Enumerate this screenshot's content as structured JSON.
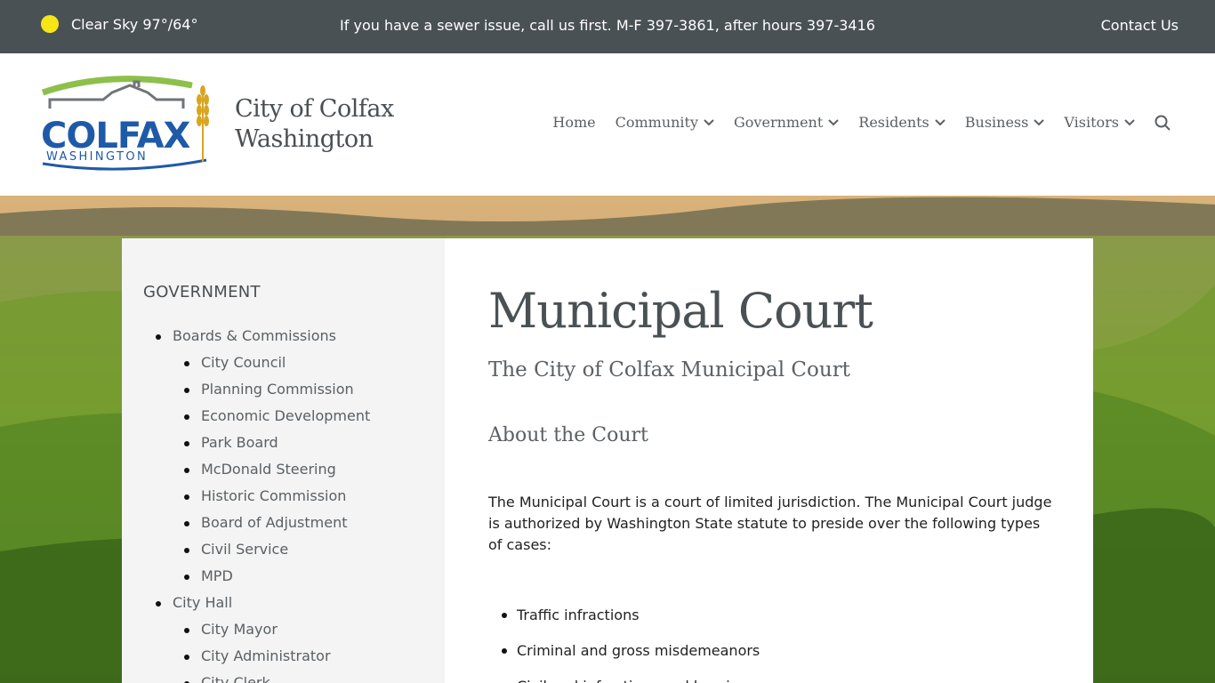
{
  "topbar": {
    "weather": "Clear Sky 97°/64°",
    "notice": "If you have a sewer issue, call us first. M-F 397-3861, after hours 397-3416",
    "contact_label": "Contact Us"
  },
  "header": {
    "logo_text": "COLFAX",
    "logo_subtext": "WASHINGTON",
    "title_line1": "City of Colfax",
    "title_line2": "Washington"
  },
  "nav": {
    "items": [
      {
        "label": "Home"
      },
      {
        "label": "Community"
      },
      {
        "label": "Government"
      },
      {
        "label": "Residents"
      },
      {
        "label": "Business"
      },
      {
        "label": "Visitors"
      }
    ]
  },
  "sidebar": {
    "heading": "GOVERNMENT",
    "sections": [
      {
        "label": "Boards & Commissions",
        "children": [
          "City Council",
          "Planning Commission",
          "Economic Development",
          "Park Board",
          "McDonald Steering",
          "Historic Commission",
          "Board of Adjustment",
          "Civil Service",
          "MPD"
        ]
      },
      {
        "label": "City Hall",
        "children": [
          "City Mayor",
          "City Administrator",
          "City Clerk"
        ]
      }
    ]
  },
  "main": {
    "title": "Municipal Court",
    "subtitle": "The City of Colfax Municipal Court",
    "about_heading": "About the Court",
    "paragraph": "The Municipal Court is a court of limited jurisdiction. The Municipal Court judge is authorized by Washington State statute to preside over the following types of cases:",
    "cases": [
      "Traffic infractions",
      "Criminal and gross misdemeanors",
      "Civil and infractions and hearings"
    ]
  },
  "colors": {
    "topbar_bg": "#4a5155",
    "sun": "#f5e617",
    "logo_blue": "#1e5aa8",
    "logo_green": "#8cc04b",
    "logo_gold": "#d9a520"
  }
}
